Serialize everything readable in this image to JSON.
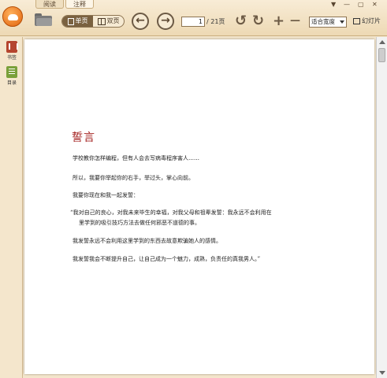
{
  "tabs": [
    {
      "label": "阅读"
    },
    {
      "label": "注释"
    }
  ],
  "window_controls": [
    "▼",
    "—",
    "▢",
    "✕"
  ],
  "toolbar": {
    "single_page_label": "单页",
    "double_page_label": "双页",
    "page_input_value": "1",
    "page_total": "/ 21页",
    "zoom_value": "适合宽度",
    "slideshow_label": "幻灯片",
    "prev_glyph": "←",
    "next_glyph": "→",
    "rotate_left_glyph": "↺",
    "rotate_right_glyph": "↻",
    "zoom_in_glyph": "+",
    "zoom_out_glyph": "—"
  },
  "sidebar": {
    "items": [
      {
        "label": "书签",
        "icon": "bookmark-icon"
      },
      {
        "label": "目录",
        "icon": "toc-icon"
      }
    ]
  },
  "document": {
    "title": "誓言",
    "paragraphs": [
      "学校教你怎样编程，但有人会去写病毒程序害人……",
      "所以，我要你举起你的右手，举过头，掌心向前。",
      "我要你现在和我一起发誓：",
      "“我对自己的良心，对我未来毕生的幸福，对我父母和祖辈发誓：我永远不会利用在",
      "里学到的吸引技巧方法去做任何邪恶不道德的事。",
      "我发誓永远不会利用这里学到的东西去故意欺骗她人的感情。",
      "我发誓我会不断提升自己，让自己成为一个魅力，成熟，负责任的真我男人。”"
    ]
  },
  "colors": {
    "accent": "#a3211f",
    "toolbar": "#f4e6cc"
  }
}
